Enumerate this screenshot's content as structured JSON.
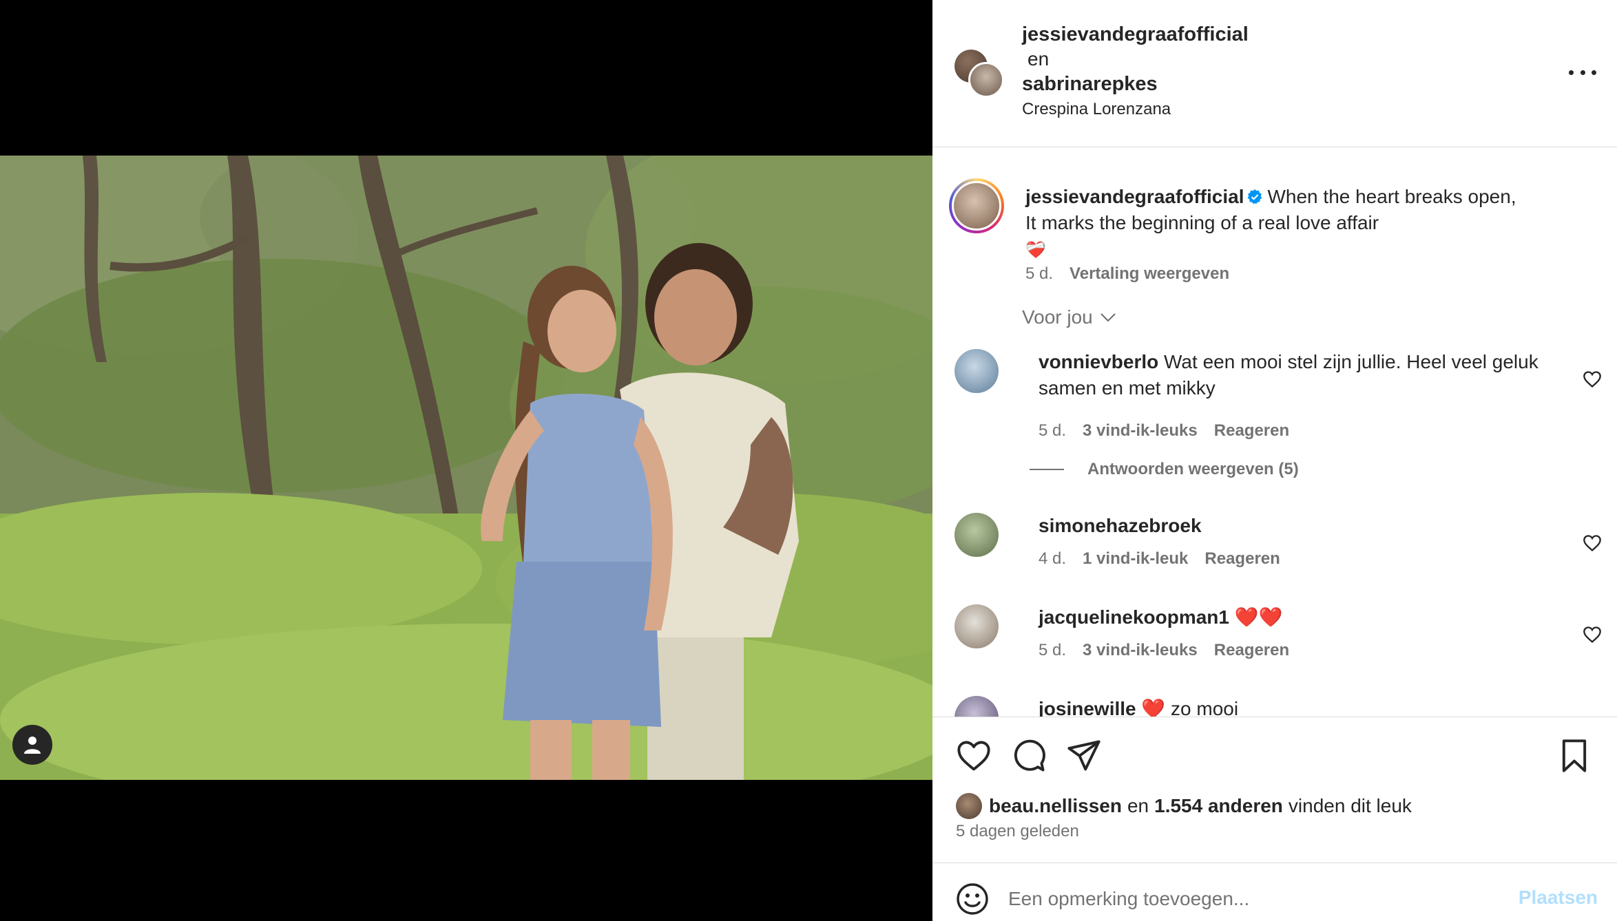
{
  "post": {
    "author_1": "jessievandegraafofficial",
    "connector": "en",
    "author_2": "sabrinarepkes",
    "location": "Crespina Lorenzana"
  },
  "caption": {
    "username": "jessievandegraafofficial",
    "line1": "When the heart breaks open,",
    "line2": "It marks the beginning of a real love affair",
    "emoji": "❤️‍🩹",
    "age": "5 d.",
    "translate": "Vertaling weergeven"
  },
  "filter": {
    "label": "Voor jou"
  },
  "comments": [
    {
      "username": "vonnievberlo",
      "text": "Wat een mooi stel zijn jullie. Heel veel geluk samen en met mikky",
      "age": "5 d.",
      "likes": "3 vind-ik-leuks",
      "reply": "Reageren"
    },
    {
      "username": "simonehazebroek",
      "text": "",
      "age": "4 d.",
      "likes": "1 vind-ik-leuk",
      "reply": "Reageren"
    },
    {
      "username": "jacquelinekoopman1",
      "text": "❤️❤️",
      "age": "5 d.",
      "likes": "3 vind-ik-leuks",
      "reply": "Reageren"
    },
    {
      "username": "josinewille",
      "text": "❤️ zo mooi"
    }
  ],
  "replies": {
    "label": "Antwoorden weergeven (5)"
  },
  "likes": {
    "first_user": "beau.nellissen",
    "connector": "en",
    "others": "1.554 anderen",
    "suffix": "vinden dit leuk"
  },
  "time_ago": "5 dagen geleden",
  "comment_box": {
    "placeholder": "Een opmerking toevoegen...",
    "post_label": "Plaatsen"
  },
  "icons": [
    "person-tag-icon",
    "more-icon",
    "verified-icon",
    "chevron-down-icon",
    "heart-icon",
    "comment-icon",
    "share-icon",
    "bookmark-icon",
    "emoji-icon"
  ],
  "colors": {
    "link_blue": "#0095f6",
    "post_disabled": "#b2dffc",
    "secondary_text": "#737373",
    "verified": "#0095f6"
  }
}
